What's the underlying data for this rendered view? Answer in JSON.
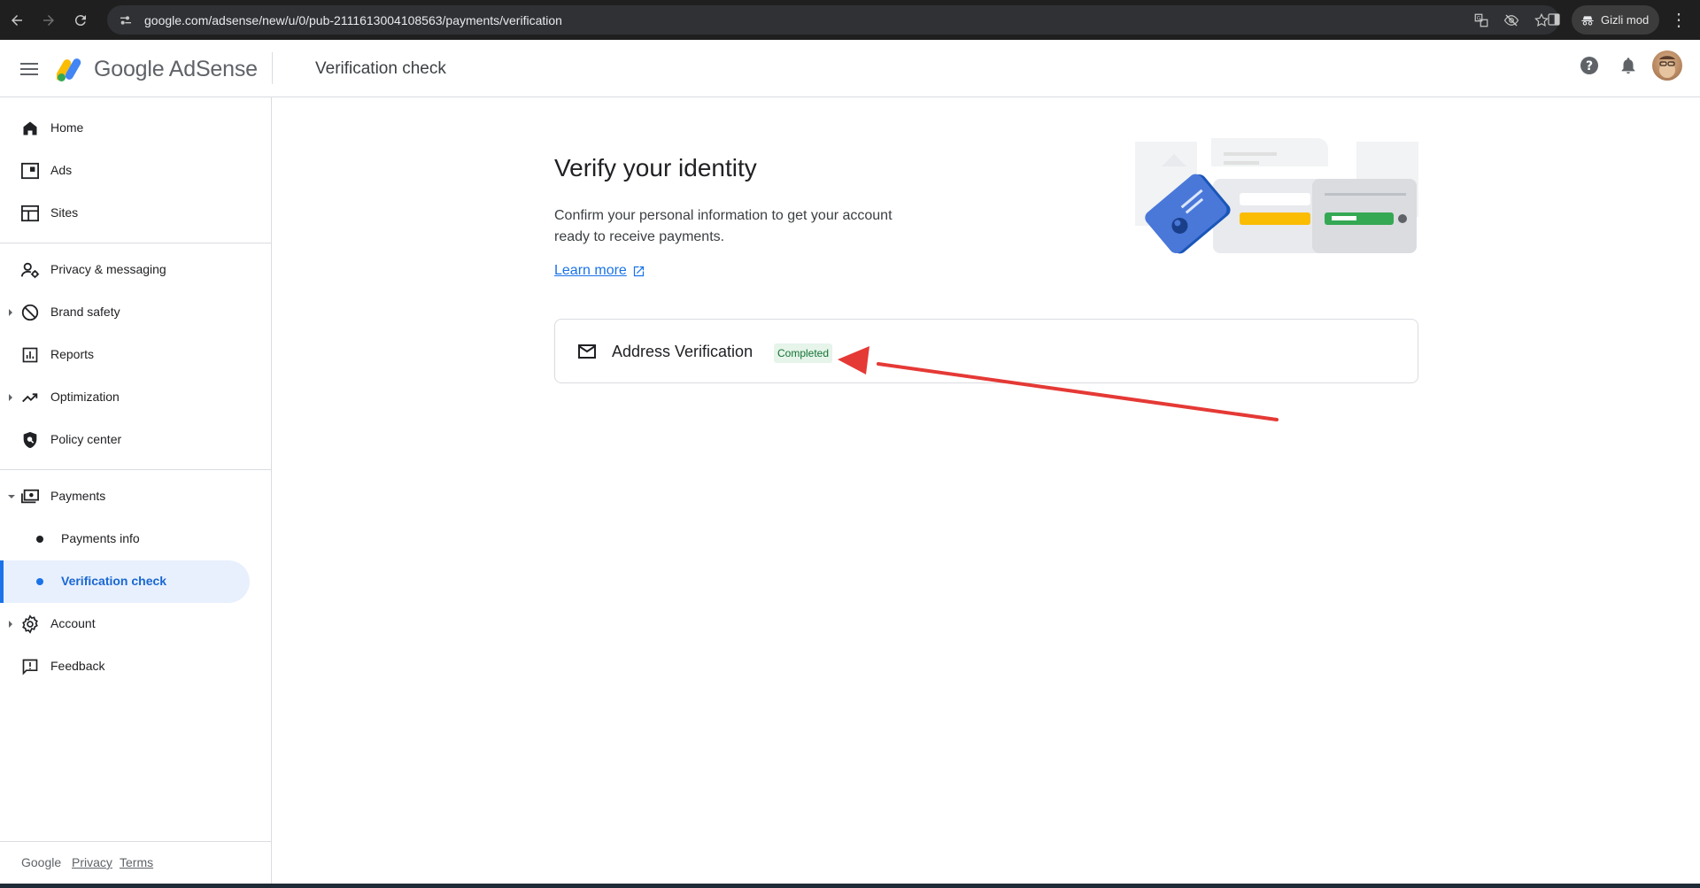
{
  "browser": {
    "url": "google.com/adsense/new/u/0/pub-2111613004108563/payments/verification",
    "profile_label": "Gizli mod"
  },
  "header": {
    "brand": "Google AdSense",
    "page_title": "Verification check"
  },
  "sidebar": {
    "items": [
      {
        "label": "Home",
        "icon": "home-icon"
      },
      {
        "label": "Ads",
        "icon": "ads-icon"
      },
      {
        "label": "Sites",
        "icon": "sites-icon"
      },
      {
        "label": "Privacy & messaging",
        "icon": "privacy-icon"
      },
      {
        "label": "Brand safety",
        "icon": "block-icon"
      },
      {
        "label": "Reports",
        "icon": "reports-icon"
      },
      {
        "label": "Optimization",
        "icon": "trending-icon"
      },
      {
        "label": "Policy center",
        "icon": "policy-icon"
      },
      {
        "label": "Payments",
        "icon": "payments-icon"
      },
      {
        "label": "Payments info",
        "icon": "bullet-icon"
      },
      {
        "label": "Verification check",
        "icon": "bullet-icon"
      },
      {
        "label": "Account",
        "icon": "gear-icon"
      },
      {
        "label": "Feedback",
        "icon": "feedback-icon"
      }
    ],
    "footer": {
      "google": "Google",
      "privacy": "Privacy",
      "terms": "Terms"
    }
  },
  "main": {
    "title": "Verify your identity",
    "description": "Confirm your personal information to get your account ready to receive payments.",
    "learn_more": "Learn more",
    "card": {
      "label": "Address Verification",
      "status": "Completed"
    }
  },
  "colors": {
    "accent": "#1a73e8",
    "success_bg": "#e6f4ea",
    "success_text": "#137333",
    "annotation_arrow": "#e53935"
  }
}
